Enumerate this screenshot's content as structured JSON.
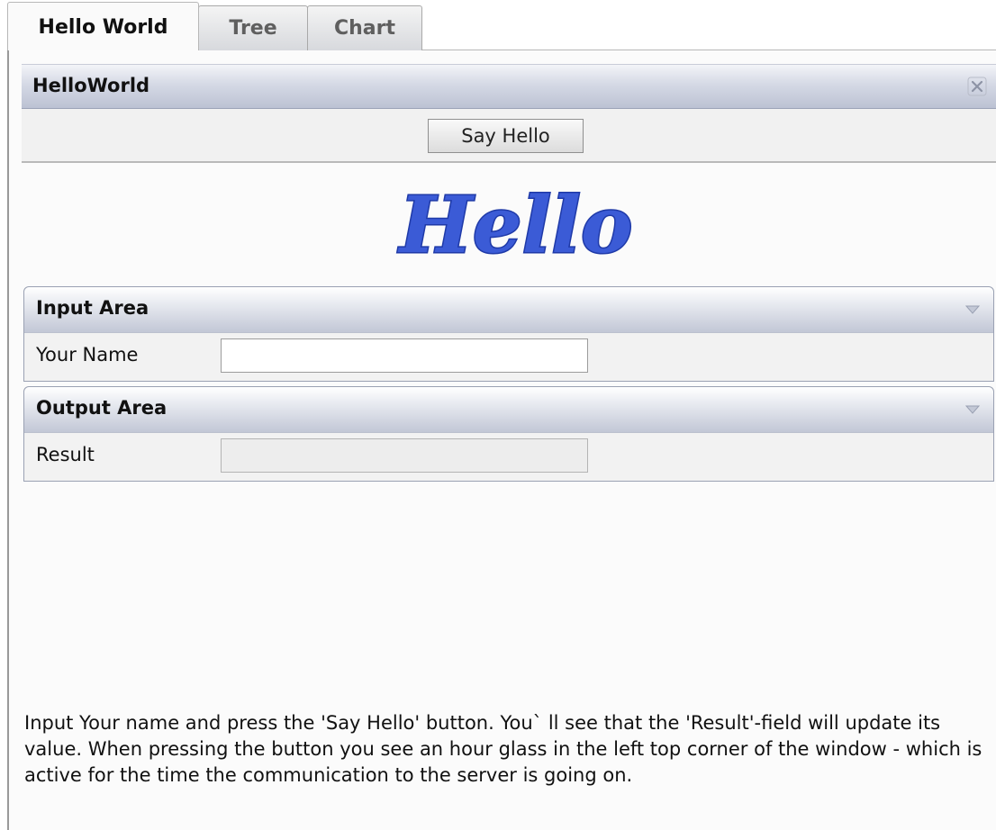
{
  "tabs": [
    {
      "label": "Hello World",
      "active": true
    },
    {
      "label": "Tree",
      "active": false
    },
    {
      "label": "Chart",
      "active": false
    }
  ],
  "panel": {
    "title": "HelloWorld",
    "close_icon": "close-icon"
  },
  "toolbar": {
    "say_hello_label": "Say Hello"
  },
  "logo": {
    "text": "Hello",
    "color": "#3b5bd6"
  },
  "input_area": {
    "title": "Input Area",
    "toggle_icon": "chevron-down-icon",
    "your_name_label": "Your Name",
    "your_name_value": ""
  },
  "output_area": {
    "title": "Output Area",
    "toggle_icon": "chevron-down-icon",
    "result_label": "Result",
    "result_value": ""
  },
  "help_text": "Input Your name and press the 'Say Hello' button. You` ll see that the 'Result'-field will update its value. When pressing the button you see an hour glass in the left top corner of the window - which is active for the time the communication to the server is going on."
}
